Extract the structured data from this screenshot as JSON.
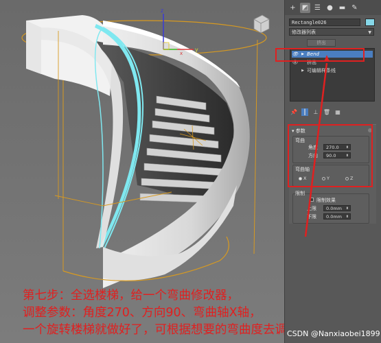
{
  "toolbar": {
    "icons": [
      "create-icon",
      "modify-icon",
      "hierarchy-icon",
      "motion-icon",
      "display-icon",
      "utilities-icon"
    ],
    "glyphs": [
      "+",
      "◩",
      "☰",
      "●",
      "▬",
      "✎"
    ]
  },
  "object": {
    "name": "Rectangle026",
    "color": "#86d7e8"
  },
  "modifier_list": {
    "label": "修改器列表"
  },
  "extrude_button": "挤出",
  "stack": {
    "items": [
      {
        "label": "Bend",
        "selected": true
      },
      {
        "label": "挤出",
        "selected": false
      },
      {
        "label": "可编辑样条线",
        "selected": false
      }
    ]
  },
  "params": {
    "title": "参数",
    "bend_group": "弯曲",
    "angle_label": "角度",
    "angle_value": "270.0",
    "direction_label": "方向",
    "direction_value": "90.0",
    "axis_group": "弯曲轴",
    "axes": [
      {
        "label": "X",
        "selected": true
      },
      {
        "label": "Y",
        "selected": false
      },
      {
        "label": "Z",
        "selected": false
      }
    ],
    "limit_group": "限制",
    "limit_effect_label": "限制效果",
    "upper_label": "上限",
    "upper_value": "0.0mm",
    "lower_label": "下限",
    "lower_value": "0.0mm"
  },
  "viewport": {
    "gizmo_x": "x",
    "gizmo_y": "y",
    "gizmo_z": "z"
  },
  "caption": {
    "line1": "第七步：全选楼梯，给一个弯曲修改器，",
    "line2": "调整参数：角度270、方向90、弯曲轴X轴，",
    "line3": "一个旋转楼梯就做好了，可根据想要的弯曲度去调整参数"
  },
  "watermark": "CSDN @Nanxiaobei1899",
  "colors": {
    "annotation_red": "#e02020",
    "selection_blue": "#4a7ec0",
    "bbox_orange": "#e0a020",
    "highlight_cyan": "#7fe8f0"
  }
}
